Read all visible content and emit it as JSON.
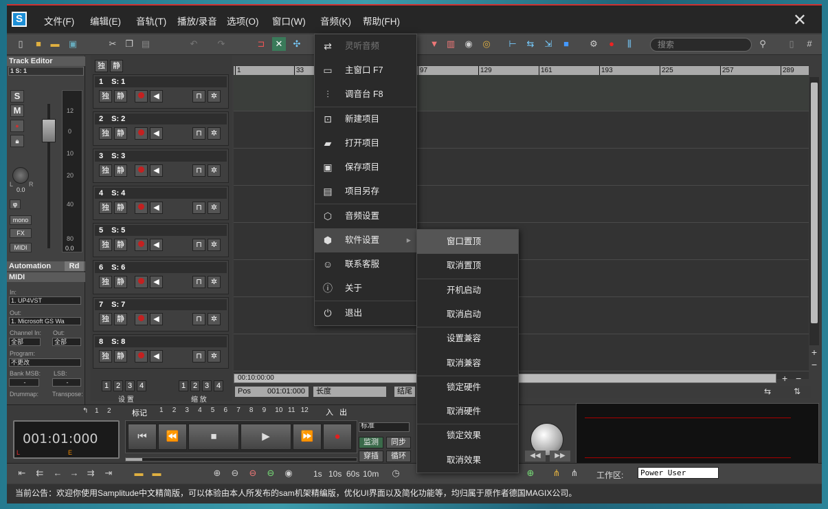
{
  "menubar": {
    "items": [
      "文件(F)",
      "编辑(E)",
      "音轨(T)",
      "播放/录音",
      "选项(O)",
      "窗口(W)",
      "音频(K)",
      "帮助(FH)"
    ]
  },
  "toolbar": {
    "search_placeholder": "搜索"
  },
  "track_editor": {
    "title": "Track Editor",
    "track_select": "1    S: 1",
    "solo": "S",
    "mute": "M",
    "vol_label": "0.0",
    "pan_l": "L",
    "pan_r": "R",
    "fader_ticks": [
      "12",
      "0",
      "10",
      "20",
      "40",
      "80",
      "0.0"
    ],
    "mono": "mono",
    "fx": "FX",
    "midi_btn": "MIDI",
    "automation": "Automation",
    "rd": "Rd",
    "midi_header": "MIDI",
    "in_label": "In:",
    "in_value": "1. UP4VST",
    "out_label": "Out:",
    "out_value": "1. Microsoft GS Wa",
    "chan_in_label": "Channel In:",
    "chan_out_label": "Out:",
    "chan_in_value": "全部",
    "chan_out_value": "全部",
    "program_label": "Program:",
    "program_value": "不更改",
    "bankmsb_label": "Bank MSB:",
    "lsb_label": "LSB:",
    "bank_value": "-",
    "lsb_value": "-",
    "drummap_label": "Drummap:",
    "transpose_label": "Transpose:"
  },
  "track_header": {
    "solo": "独",
    "mute": "静"
  },
  "tracks": [
    {
      "num": "1",
      "name": "S: 1"
    },
    {
      "num": "2",
      "name": "S: 2"
    },
    {
      "num": "3",
      "name": "S: 3"
    },
    {
      "num": "4",
      "name": "S: 4"
    },
    {
      "num": "5",
      "name": "S: 5"
    },
    {
      "num": "6",
      "name": "S: 6"
    },
    {
      "num": "7",
      "name": "S: 7"
    },
    {
      "num": "8",
      "name": "S: 8"
    }
  ],
  "track_buttons": {
    "solo": "独",
    "mute": "静"
  },
  "group_buttons": {
    "set_nums": [
      "1",
      "2",
      "3",
      "4"
    ],
    "zoom_nums": [
      "1",
      "2",
      "3",
      "4"
    ],
    "set_label": "设 置",
    "zoom_label": "缩 放"
  },
  "ruler": {
    "ticks": [
      "1",
      "33",
      "97",
      "129",
      "161",
      "193",
      "225",
      "257",
      "289"
    ]
  },
  "timeline": {
    "scroll_time": "00:10:00:00",
    "pos_label": "Pos",
    "pos_value": "001:01:000",
    "length_label": "长度",
    "end_label": "结尾"
  },
  "dropdown_menu": {
    "items": [
      {
        "icon": "listen-icon",
        "label": "灵听音频",
        "disabled": true
      },
      {
        "icon": "window-icon",
        "label": "主窗口  F7"
      },
      {
        "icon": "mixer-icon",
        "label": "调音台  F8"
      },
      {
        "icon": "new-project-icon",
        "label": "新建项目"
      },
      {
        "icon": "folder-icon",
        "label": "打开项目"
      },
      {
        "icon": "save-icon",
        "label": "保存项目"
      },
      {
        "icon": "save-as-icon",
        "label": "项目另存"
      },
      {
        "icon": "audio-settings-icon",
        "label": "音频设置"
      },
      {
        "icon": "software-settings-icon",
        "label": "软件设置"
      },
      {
        "icon": "support-icon",
        "label": "联系客服"
      },
      {
        "icon": "info-icon",
        "label": "关于"
      },
      {
        "icon": "power-icon",
        "label": "退出"
      }
    ]
  },
  "submenu": {
    "items": [
      "窗口置顶",
      "取消置顶",
      "开机启动",
      "取消启动",
      "设置兼容",
      "取消兼容",
      "锁定硬件",
      "取消硬件",
      "锁定效果",
      "取消效果"
    ]
  },
  "transport": {
    "markers_label": "标记",
    "marker_nums": [
      "1",
      "2",
      "3",
      "4",
      "5",
      "6",
      "7",
      "8",
      "9",
      "10",
      "11",
      "12"
    ],
    "in_label": "入",
    "out_label": "出",
    "loop_nums": [
      "1",
      "2"
    ],
    "time": "001:01:000",
    "l_label": "L",
    "e_label": "E",
    "mode": "标准",
    "monitor": "监测",
    "sync": "同步",
    "punch": "穿插",
    "loop": "循环"
  },
  "bottombar": {
    "times": [
      "1s",
      "10s",
      "60s",
      "10m"
    ],
    "workspace_label": "工作区:",
    "workspace_value": "Power User"
  },
  "status": {
    "text": "当前公告：欢迎你使用Samplitude中文精简版，可以体验由本人所发布的sam机架精编版，优化UI界面以及简化功能等，均归属于原作者德国MAGIX公司。"
  }
}
